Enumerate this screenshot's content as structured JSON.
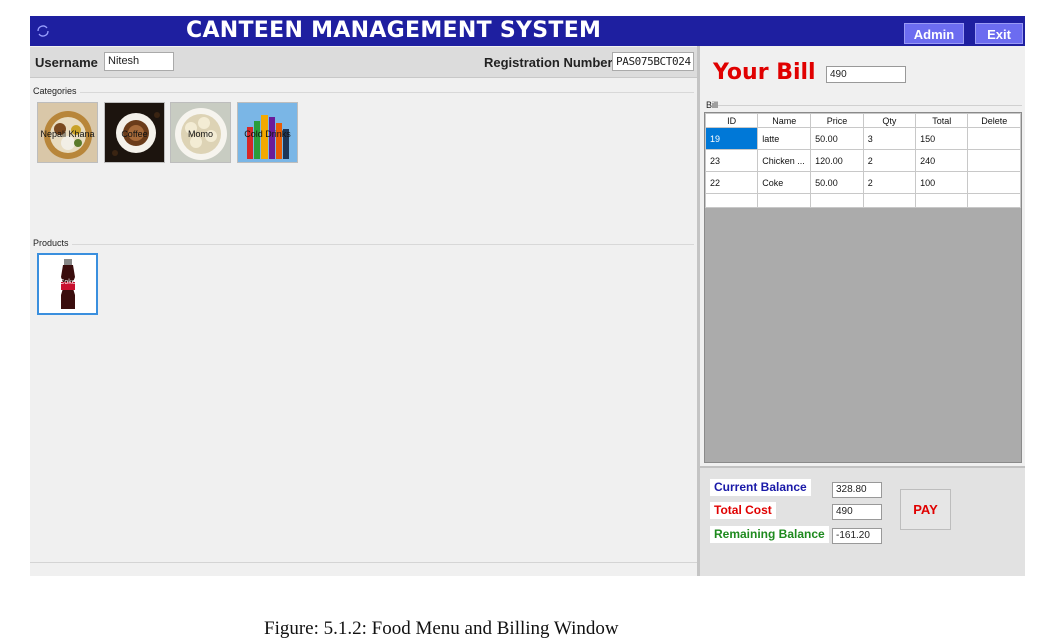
{
  "app": {
    "title": "CANTEEN MANAGEMENT SYSTEM",
    "admin_label": "Admin",
    "exit_label": "Exit"
  },
  "user": {
    "username_label": "Username",
    "username_value": "Nitesh",
    "reg_label": "Registration Number",
    "reg_value": "PAS075BCT024"
  },
  "categories": {
    "label": "Categories",
    "items": [
      {
        "label": "Nepali Khana",
        "icon": "nepali-food-image"
      },
      {
        "label": "Coffee",
        "icon": "coffee-image"
      },
      {
        "label": "Momo",
        "icon": "momo-image"
      },
      {
        "label": "Cold Drinks",
        "icon": "cold-drinks-image"
      }
    ]
  },
  "products": {
    "label": "Products",
    "items": [
      {
        "label": "Coke",
        "icon": "coke-bottle-image"
      }
    ]
  },
  "bill": {
    "title": "Your Bill",
    "total": "490",
    "group_label": "Bill",
    "columns": [
      "ID",
      "Name",
      "Price",
      "Qty",
      "Total",
      "Delete"
    ],
    "rows": [
      [
        "19",
        "latte",
        "50.00",
        "3",
        "150",
        ""
      ],
      [
        "23",
        "Chicken ...",
        "120.00",
        "2",
        "240",
        ""
      ],
      [
        "22",
        "Coke",
        "50.00",
        "2",
        "100",
        ""
      ]
    ]
  },
  "payment": {
    "current_balance_label": "Current Balance",
    "current_balance": "328.80",
    "total_cost_label": "Total Cost",
    "total_cost": "490",
    "remaining_balance_label": "Remaining Balance",
    "remaining_balance": "-161.20",
    "pay_label": "PAY"
  },
  "colors": {
    "titlebar": "#1e1fa0",
    "top_button": "#6c6cf0",
    "bill_title": "#e00000",
    "current_balance": "#1a1aa8",
    "remaining_balance": "#1e8a1e",
    "selected_cell": "#0078d7"
  },
  "caption": "Figure: 5.1.2:  Food Menu and Billing Window"
}
